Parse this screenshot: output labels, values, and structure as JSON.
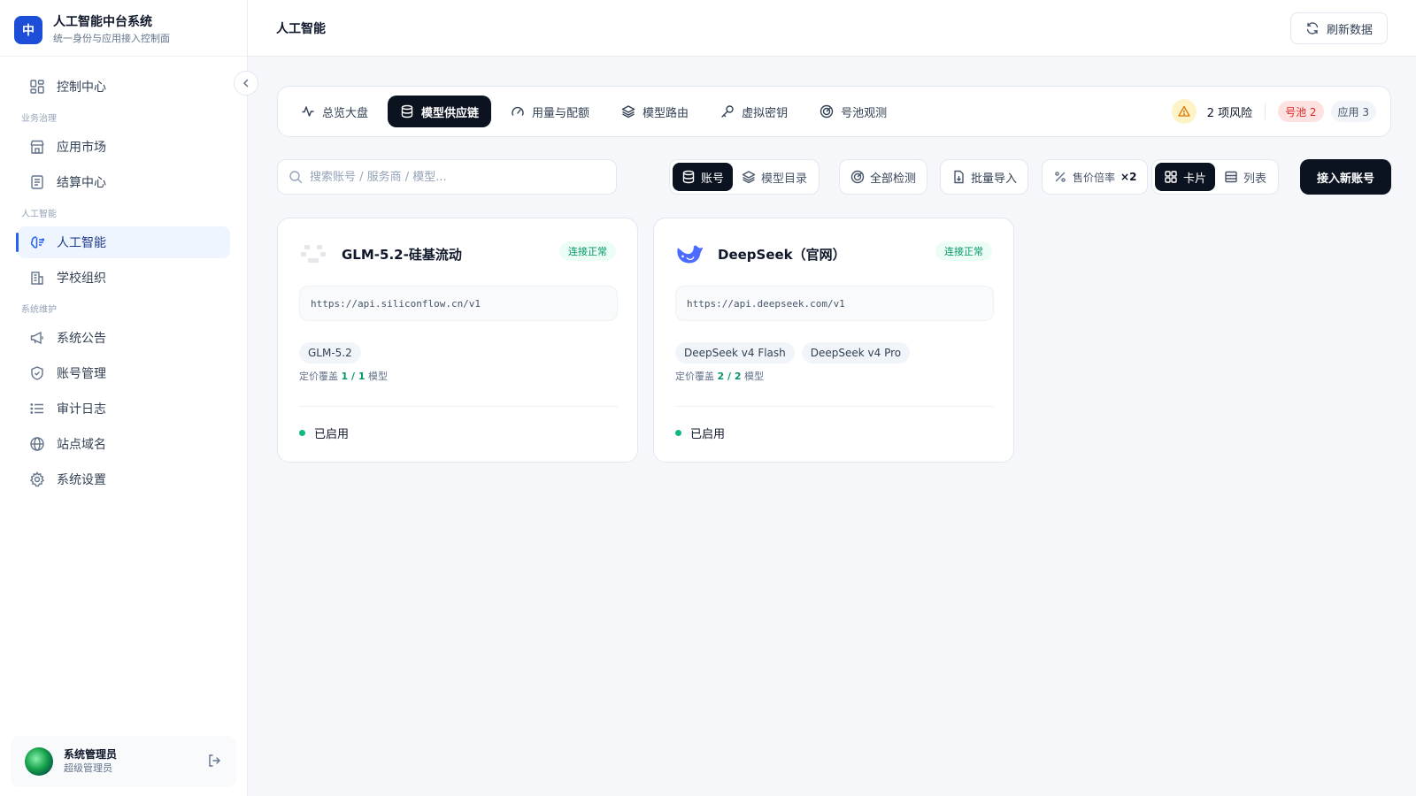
{
  "brand": {
    "logo_char": "中",
    "title": "人工智能中台系统",
    "subtitle": "统一身份与应用接入控制面"
  },
  "sidebar": {
    "items": [
      {
        "label": "控制中心",
        "icon": "grid-icon"
      },
      {
        "group": "业务治理"
      },
      {
        "label": "应用市场",
        "icon": "store-icon"
      },
      {
        "label": "结算中心",
        "icon": "document-icon"
      },
      {
        "group": "人工智能"
      },
      {
        "label": "人工智能",
        "icon": "brain-icon",
        "active": true
      },
      {
        "label": "学校组织",
        "icon": "building-icon"
      },
      {
        "group": "系统维护"
      },
      {
        "label": "系统公告",
        "icon": "megaphone-icon"
      },
      {
        "label": "账号管理",
        "icon": "shield-icon"
      },
      {
        "label": "审计日志",
        "icon": "list-icon"
      },
      {
        "label": "站点域名",
        "icon": "globe-icon"
      },
      {
        "label": "系统设置",
        "icon": "gear-icon"
      }
    ],
    "labels": {
      "control": "控制中心",
      "group_business": "业务治理",
      "market": "应用市场",
      "billing": "结算中心",
      "group_ai": "人工智能",
      "ai": "人工智能",
      "school": "学校组织",
      "group_sys": "系统维护",
      "notice": "系统公告",
      "accounts": "账号管理",
      "audit": "审计日志",
      "domains": "站点域名",
      "settings": "系统设置"
    }
  },
  "user": {
    "name": "系统管理员",
    "role": "超级管理员"
  },
  "header": {
    "title": "人工智能",
    "refresh_label": "刷新数据"
  },
  "tabs": {
    "overview": "总览大盘",
    "supply": "模型供应链",
    "usage": "用量与配额",
    "routing": "模型路由",
    "keys": "虚拟密钥",
    "pool": "号池观测"
  },
  "risk": {
    "text": "2 项风险",
    "pool_badge": "号池 2",
    "app_badge": "应用 3"
  },
  "toolbar": {
    "search_placeholder": "搜索账号 / 服务商 / 模型...",
    "seg_accounts": "账号",
    "seg_catalog": "模型目录",
    "check_all": "全部检测",
    "batch_import": "批量导入",
    "markup_label": "售价倍率",
    "markup_value": "×2",
    "view_card": "卡片",
    "view_list": "列表",
    "connect_new": "接入新账号"
  },
  "accounts": [
    {
      "name": "GLM-5.2-硅基流动",
      "status": "连接正常",
      "url": "https://api.siliconflow.cn/v1",
      "models": [
        "GLM-5.2"
      ],
      "coverage_prefix": "定价覆盖",
      "coverage_value": "1 / 1",
      "coverage_suffix": "模型",
      "enabled_label": "已启用",
      "logo": "siliconflow-logo-icon"
    },
    {
      "name": "DeepSeek（官网）",
      "status": "连接正常",
      "url": "https://api.deepseek.com/v1",
      "models": [
        "DeepSeek v4 Flash",
        "DeepSeek v4 Pro"
      ],
      "coverage_prefix": "定价覆盖",
      "coverage_value": "2 / 2",
      "coverage_suffix": "模型",
      "enabled_label": "已启用",
      "logo": "deepseek-whale-icon"
    }
  ],
  "colors": {
    "accent": "#2563eb",
    "primary_dark": "#0b1220",
    "success": "#10b981",
    "danger": "#dc2626",
    "warning_bg": "#fef3c7"
  }
}
